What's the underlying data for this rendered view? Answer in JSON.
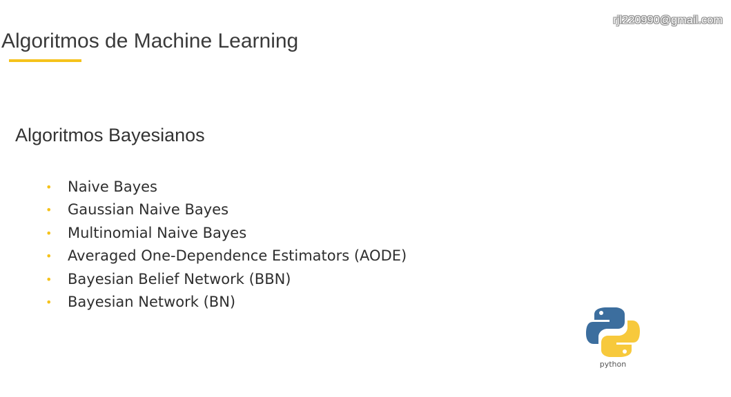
{
  "watermark": {
    "text": "rjl220990@gmail.com"
  },
  "header": {
    "title": "Algoritmos de Machine Learning"
  },
  "content": {
    "subtitle": "Algoritmos Bayesianos",
    "items": [
      {
        "label": "Naive Bayes"
      },
      {
        "label": "Gaussian Naive Bayes"
      },
      {
        "label": "Multinomial Naive Bayes"
      },
      {
        "label": "Averaged One-Dependence Estimators (AODE)"
      },
      {
        "label": "Bayesian Belief Network (BBN)"
      },
      {
        "label": "Bayesian Network (BN)"
      }
    ]
  },
  "logo": {
    "icon": "python-logo-icon",
    "wordmark": "python"
  },
  "colors": {
    "accent": "#f5c21b",
    "python_blue": "#3c6e9e",
    "python_yellow": "#f7c93c",
    "text": "#333333"
  }
}
